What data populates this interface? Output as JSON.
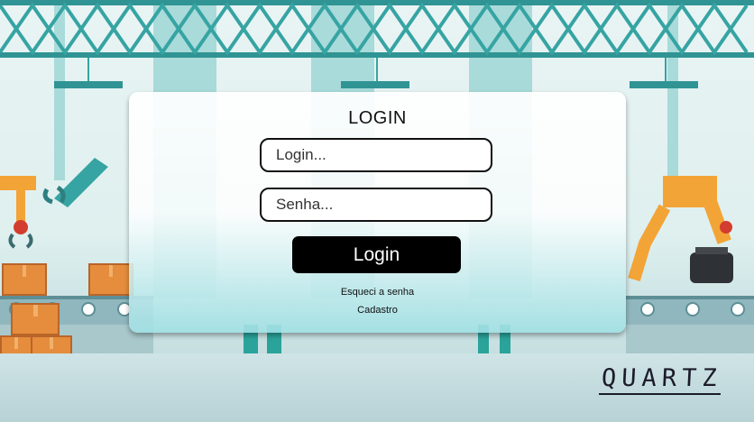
{
  "login_card": {
    "title": "LOGIN",
    "login_placeholder": "Login...",
    "password_placeholder": "Senha...",
    "submit_label": "Login",
    "forgot_password_link": "Esqueci a senha",
    "register_link": "Cadastro"
  },
  "brand": {
    "logo_text": "QUARTZ"
  },
  "colors": {
    "accent": "#000000",
    "truss": "#36a4a3",
    "box": "#e58d3c"
  }
}
